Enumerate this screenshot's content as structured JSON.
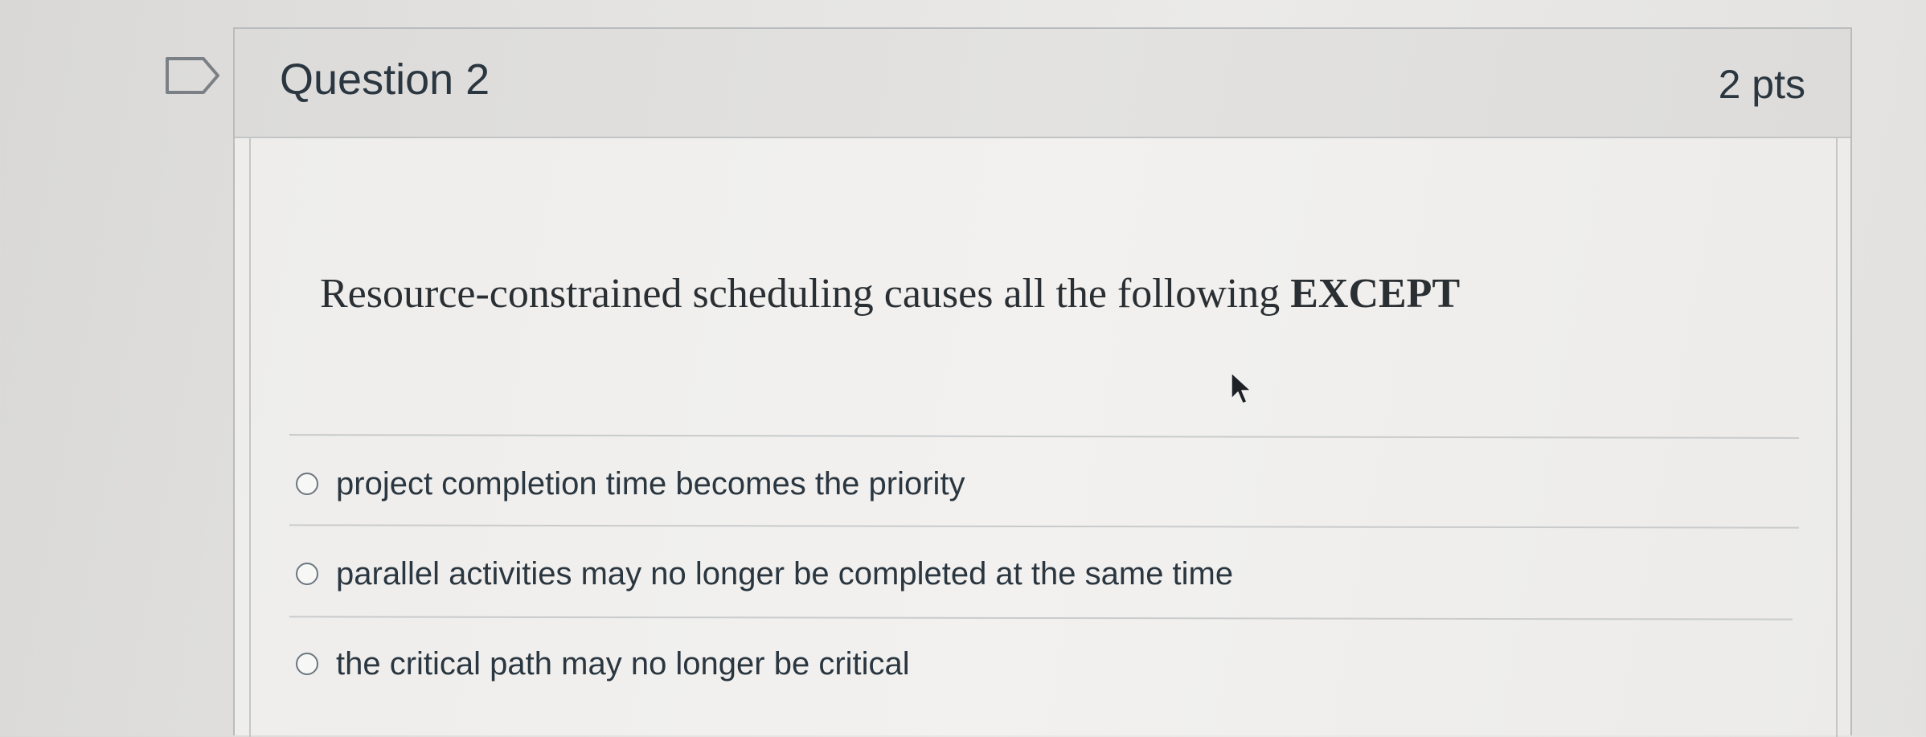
{
  "question": {
    "title": "Question 2",
    "points": "2 pts",
    "text_main": "Resource-constrained scheduling causes all the following ",
    "text_emphasis": "EXCEPT"
  },
  "answers": [
    {
      "label": "project completion time becomes the priority",
      "selected": false
    },
    {
      "label": "parallel activities may no longer be completed at the same time",
      "selected": false
    },
    {
      "label": "the critical path may no longer be critical",
      "selected": false
    }
  ],
  "icons": {
    "flag": "flag-question-icon",
    "cursor": "mouse-pointer-icon"
  },
  "colors": {
    "text": "#2a3640",
    "border": "#b9bbbd",
    "header_bg": "#e0dfdd"
  }
}
